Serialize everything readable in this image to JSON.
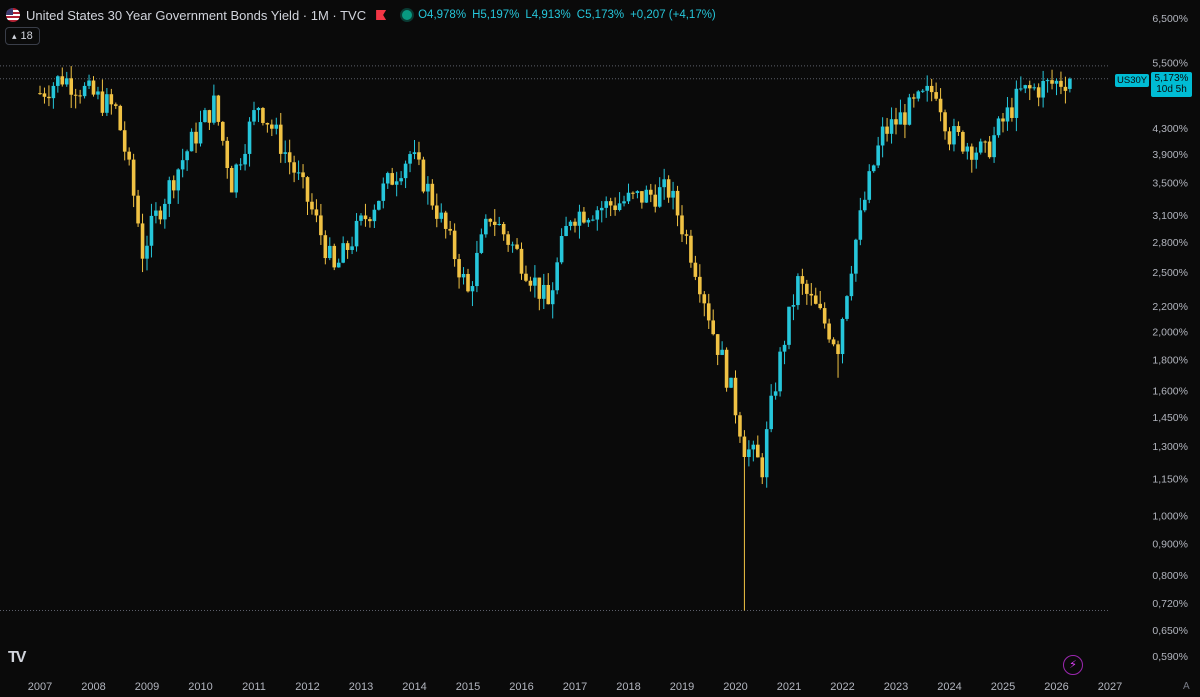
{
  "header": {
    "title": "United States 30 Year Government Bonds Yield · 1M · TVC",
    "open": "O4,978%",
    "high": "H5,197%",
    "low": "L4,913%",
    "close": "C5,173%",
    "change": "+0,207 (+4,17%)"
  },
  "indicator_badge": {
    "count": "18"
  },
  "price_tag": {
    "symbol": "US30Y",
    "value": "5,173%",
    "countdown": "10d 5h"
  },
  "colors": {
    "up": "#26c6da",
    "down": "#f0c244",
    "background": "#0a0a0a",
    "axis_text": "#b2b5be"
  },
  "chart_data": {
    "type": "candlestick",
    "y_scale": "log",
    "ylim": [
      0.55,
      6.8
    ],
    "y_ticks": [
      {
        "v": 6.5,
        "label": "6,500%"
      },
      {
        "v": 5.5,
        "label": "5,500%"
      },
      {
        "v": 4.3,
        "label": "4,300%"
      },
      {
        "v": 3.9,
        "label": "3,900%"
      },
      {
        "v": 3.5,
        "label": "3,500%"
      },
      {
        "v": 3.1,
        "label": "3,100%"
      },
      {
        "v": 2.8,
        "label": "2,800%"
      },
      {
        "v": 2.5,
        "label": "2,500%"
      },
      {
        "v": 2.2,
        "label": "2,200%"
      },
      {
        "v": 2.0,
        "label": "2,000%"
      },
      {
        "v": 1.8,
        "label": "1,800%"
      },
      {
        "v": 1.6,
        "label": "1,600%"
      },
      {
        "v": 1.45,
        "label": "1,450%"
      },
      {
        "v": 1.3,
        "label": "1,300%"
      },
      {
        "v": 1.15,
        "label": "1,150%"
      },
      {
        "v": 1.0,
        "label": "1,000%"
      },
      {
        "v": 0.9,
        "label": "0,900%"
      },
      {
        "v": 0.8,
        "label": "0,800%"
      },
      {
        "v": 0.72,
        "label": "0,720%"
      },
      {
        "v": 0.65,
        "label": "0,650%"
      },
      {
        "v": 0.59,
        "label": "0,590%"
      }
    ],
    "x_ticks": [
      "2007",
      "2008",
      "2009",
      "2010",
      "2011",
      "2012",
      "2013",
      "2014",
      "2015",
      "2016",
      "2017",
      "2018",
      "2019",
      "2020",
      "2021",
      "2022",
      "2023",
      "2024",
      "2025",
      "2026",
      "2027"
    ],
    "reference_lines": [
      {
        "value": 5.173,
        "label": "last close"
      },
      {
        "value": 5.43,
        "label": "high"
      },
      {
        "value": 0.7,
        "label": "low"
      }
    ],
    "series_key_points": [
      {
        "t": "2007",
        "close": 4.9
      },
      {
        "t": "2007-06",
        "close": 5.2
      },
      {
        "t": "2008-06",
        "close": 4.6
      },
      {
        "t": "2008-12",
        "close": 2.7
      },
      {
        "t": "2010-04",
        "close": 4.7
      },
      {
        "t": "2010-08",
        "close": 3.5
      },
      {
        "t": "2011-02",
        "close": 4.7
      },
      {
        "t": "2012-07",
        "close": 2.5
      },
      {
        "t": "2013-12",
        "close": 3.9
      },
      {
        "t": "2015-01",
        "close": 2.3
      },
      {
        "t": "2015-06",
        "close": 3.1
      },
      {
        "t": "2016-07",
        "close": 2.2
      },
      {
        "t": "2016-12",
        "close": 3.1
      },
      {
        "t": "2018-10",
        "close": 3.4
      },
      {
        "t": "2019-08",
        "close": 2.0
      },
      {
        "t": "2020-03",
        "close": 1.3
      },
      {
        "t": "2020-07",
        "close": 1.2
      },
      {
        "t": "2021-03",
        "close": 2.4
      },
      {
        "t": "2021-12",
        "close": 1.9
      },
      {
        "t": "2022-10",
        "close": 4.2
      },
      {
        "t": "2023-10",
        "close": 5.0
      },
      {
        "t": "2024-01",
        "close": 4.2
      },
      {
        "t": "2024-09",
        "close": 3.9
      },
      {
        "t": "2025-05",
        "close": 4.9
      },
      {
        "t": "2026-04",
        "close": 5.173
      }
    ]
  }
}
